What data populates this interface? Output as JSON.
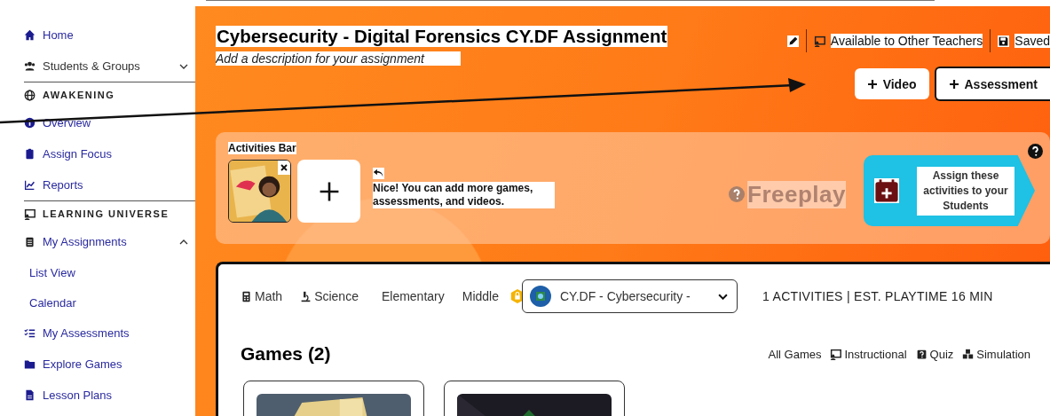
{
  "sidebar": {
    "items": [
      {
        "kind": "link",
        "label": "Home"
      },
      {
        "kind": "link",
        "label": "Students & Groups",
        "expanded": false
      },
      {
        "kind": "section",
        "label": "AWAKENING"
      },
      {
        "kind": "link",
        "label": "Overview"
      },
      {
        "kind": "link",
        "label": "Assign Focus"
      },
      {
        "kind": "link",
        "label": "Reports"
      },
      {
        "kind": "section",
        "label": "LEARNING UNIVERSE"
      },
      {
        "kind": "link",
        "label": "My Assignments",
        "expanded": true,
        "children": [
          {
            "label": "List View"
          },
          {
            "label": "Calendar"
          }
        ]
      },
      {
        "kind": "link",
        "label": "My Assessments"
      },
      {
        "kind": "link",
        "label": "Explore Games"
      },
      {
        "kind": "link",
        "label": "Lesson Plans"
      }
    ]
  },
  "assignment": {
    "title": "Cybersecurity - Digital Forensics CY.DF Assignment",
    "description": {
      "placeholder": "Add a description for your assignment"
    },
    "sharing": "Available to Other Teachers",
    "save_status": "Saved",
    "buttons": [
      "Video",
      "Assessment"
    ]
  },
  "activities_bar": {
    "title": "Activities Bar",
    "hint": "Nice! You can add more games, assessments, and videos.",
    "mode": "Freeplay",
    "assign_button": "Assign these activities to your Students"
  },
  "library": {
    "filters": [
      "Math",
      "Science",
      "Elementary",
      "Middle"
    ],
    "course_select": "CY.DF - Cybersecurity -",
    "summary": "1 ACTIVITIES | EST. PLAYTIME 16 MIN",
    "section_title": "Games (2)",
    "game_types": [
      "All Games",
      "Instructional",
      "Quiz",
      "Simulation"
    ]
  }
}
